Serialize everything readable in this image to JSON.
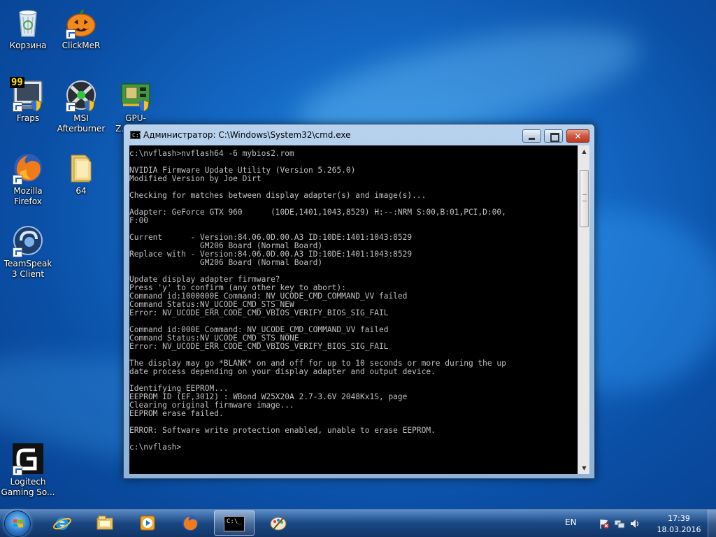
{
  "desktop": {
    "icons": [
      {
        "label": "Корзина",
        "icon": "recycle-bin-icon"
      },
      {
        "label": "ClickMeR",
        "icon": "pumpkin-icon"
      },
      {
        "label": "Fraps",
        "icon": "fraps-icon"
      },
      {
        "label": "MSI Afterburner",
        "icon": "msi-afterburner-icon"
      },
      {
        "label": "GPU-Z.0.8.6....",
        "icon": "gpuz-icon"
      },
      {
        "label": "Mozilla Firefox",
        "icon": "firefox-icon"
      },
      {
        "label": "64",
        "icon": "folder-icon"
      },
      {
        "label": "TeamSpeak 3 Client",
        "icon": "teamspeak-icon"
      },
      {
        "label": "Logitech Gaming So...",
        "icon": "logitech-g-icon"
      }
    ],
    "fraps_badge": "99"
  },
  "window": {
    "title": "Администратор: C:\\Windows\\System32\\cmd.exe",
    "icon_glyph": "C:\\_",
    "console_text": "c:\\nvflash>nvflash64 -6 mybios2.rom\n\nNVIDIA Firmware Update Utility (Version 5.265.0)\nModified Version by Joe Dirt\n\nChecking for matches between display adapter(s) and image(s)...\n\nAdapter: GeForce GTX 960      (10DE,1401,1043,8529) H:--:NRM S:00,B:01,PCI,D:00,\nF:00\n\nCurrent      - Version:84.06.0D.00.A3 ID:10DE:1401:1043:8529\n               GM206 Board (Normal Board)\nReplace with - Version:84.06.0D.00.A3 ID:10DE:1401:1043:8529\n               GM206 Board (Normal Board)\n\nUpdate display adapter firmware?\nPress 'y' to confirm (any other key to abort):\nCommand id:1000000E Command: NV_UCODE_CMD_COMMAND_VV failed\nCommand Status:NV_UCODE_CMD_STS_NEW\nError: NV_UCODE_ERR_CODE_CMD_VBIOS_VERIFY_BIOS_SIG_FAIL\n\nCommand id:000E Command: NV_UCODE_CMD_COMMAND_VV failed\nCommand Status:NV_UCODE_CMD_STS_NONE\nError: NV_UCODE_ERR_CODE_CMD_VBIOS_VERIFY_BIOS_SIG_FAIL\n\nThe display may go *BLANK* on and off for up to 10 seconds or more during the up\ndate process depending on your display adapter and output device.\n\nIdentifying EEPROM...\nEEPROM ID (EF,3012) : WBond W25X20A 2.7-3.6V 2048Kx1S, page\nClearing original firmware image...\nEEPROM erase failed.\n\nERROR: Software write protection enabled, unable to erase EEPROM.\n\nc:\\nvflash>"
  },
  "taskbar": {
    "items": [
      "internet-explorer-icon",
      "file-explorer-icon",
      "media-player-icon",
      "firefox-icon",
      "cmd-icon",
      "paint-icon"
    ],
    "active": "cmd-icon",
    "language": "EN",
    "time": "17:39",
    "date": "18.03.2016",
    "cmd_glyph": "C:\\_"
  },
  "colors": {
    "desktop_blue": "#1469c4",
    "console_bg": "#000000",
    "console_text": "#c0c0c0",
    "close_red": "#c23a20"
  }
}
